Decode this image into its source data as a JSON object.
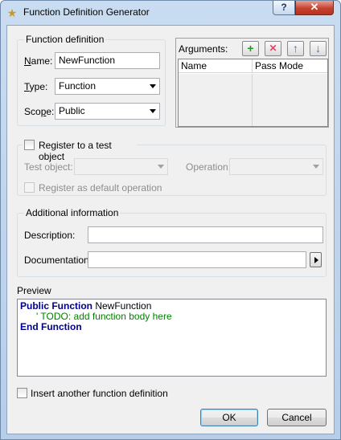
{
  "window": {
    "title": "Function Definition Generator",
    "help_label": "?",
    "close_label": "✕"
  },
  "function_definition": {
    "group_label": "Function definition",
    "name_label": "Name:",
    "name_value": "NewFunction",
    "type_label": "Type:",
    "type_value": "Function",
    "scope_label": "Scope:",
    "scope_value": "Public"
  },
  "arguments": {
    "label": "Arguments:",
    "columns": [
      "Name",
      "Pass Mode"
    ],
    "buttons": {
      "add": "+",
      "delete": "✕",
      "up": "↑",
      "down": "↓"
    }
  },
  "register": {
    "checkbox_label": "Register to a test object",
    "test_object_label": "Test object:",
    "test_object_value": "",
    "operation_label": "Operation:",
    "operation_value": "",
    "default_operation_label": "Register as default operation"
  },
  "additional": {
    "group_label": "Additional information",
    "description_label": "Description:",
    "description_value": "",
    "documentation_label": "Documentation:",
    "documentation_value": ""
  },
  "preview": {
    "label": "Preview",
    "line1_kw": "Public Function",
    "line1_name": " NewFunction",
    "line2": "' TODO: add function body here",
    "line3_kw": "End Function"
  },
  "footer": {
    "insert_another_label": "Insert another function definition",
    "ok_label": "OK",
    "cancel_label": "Cancel"
  },
  "colors": {
    "keyword": "#00008b",
    "comment": "#008000",
    "add_icon": "#1f9a1f",
    "delete_icon": "#e0476c",
    "arrow_icon": "#2f78c4"
  }
}
